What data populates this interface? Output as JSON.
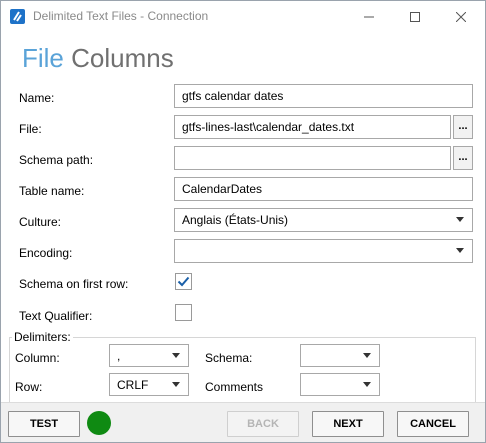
{
  "window": {
    "title": "Delimited Text Files - Connection",
    "minimize_icon": "minimize-icon",
    "maximize_icon": "maximize-icon",
    "close_icon": "close-icon"
  },
  "heading": {
    "part1": "File",
    "part2": "Columns"
  },
  "form": {
    "name_label": "Name:",
    "name_value": "gtfs calendar dates",
    "file_label": "File:",
    "file_value": "gtfs-lines-last\\calendar_dates.txt",
    "file_browse": "...",
    "schema_path_label": "Schema path:",
    "schema_path_value": "",
    "schema_browse": "...",
    "table_name_label": "Table name:",
    "table_name_value": "CalendarDates",
    "culture_label": "Culture:",
    "culture_value": "Anglais (États-Unis)",
    "encoding_label": "Encoding:",
    "encoding_value": "",
    "schema_first_row_label": "Schema on first row:",
    "schema_first_row_checked": true,
    "text_qualifier_label": "Text Qualifier:",
    "text_qualifier_checked": false
  },
  "delimiters": {
    "legend": "Delimiters:",
    "column_label": "Column:",
    "column_value": ",",
    "schema_label": "Schema:",
    "schema_value": "",
    "row_label": "Row:",
    "row_value": "CRLF",
    "comments_label": "Comments",
    "comments_value": ""
  },
  "footer": {
    "test": "TEST",
    "status_color": "#0f8a12",
    "back": "BACK",
    "next": "NEXT",
    "cancel": "CANCEL"
  },
  "colors": {
    "accent": "#5aa3d8",
    "heading_gray": "#707070",
    "checkmark": "#1a5fa8"
  }
}
